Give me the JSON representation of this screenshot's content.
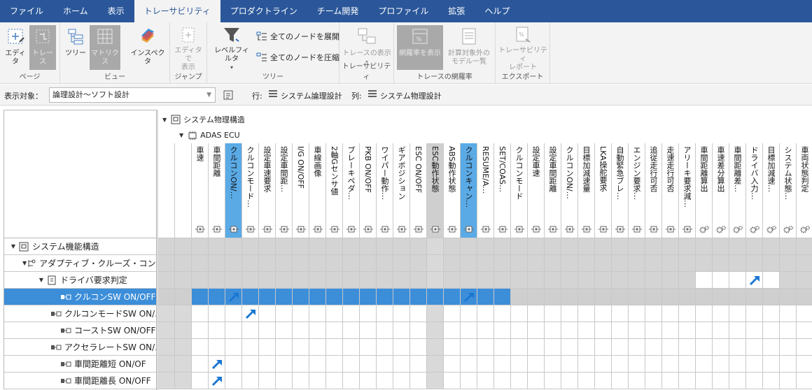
{
  "menu": {
    "tabs": [
      "ファイル",
      "ホーム",
      "表示",
      "トレーサビリティ",
      "プロダクトライン",
      "チーム開発",
      "プロファイル",
      "拡張",
      "ヘルプ"
    ],
    "active_index": 3
  },
  "ribbon": {
    "groups": {
      "page": "ページ",
      "view": "ビュー",
      "jump": "ジャンプ",
      "tree": "ツリー",
      "traceability": "トレーサビリティ",
      "coverage": "トレースの網羅率",
      "export": "エクスポート"
    },
    "buttons": {
      "editor": "エディタ",
      "trace": "トレース",
      "tree": "ツリー",
      "matrix": "マトリクス",
      "inspector": "インスペクタ",
      "show_in_editor_1": "エディタで",
      "show_in_editor_2": "表示",
      "level_filter": "レベルフィルタ",
      "expand_all": "全てのノードを展開",
      "collapse_all": "全てのノードを圧縮",
      "trace_display": "トレースの表示",
      "coverage_display": "網羅率を表示",
      "excluded_models_1": "計算対象外の",
      "excluded_models_2": "モデル一覧",
      "trace_report_1": "トレーサビリティ",
      "trace_report_2": "レポート"
    }
  },
  "options": {
    "target_label": "表示対象：",
    "target_value": "論理設計～ソフト設計",
    "row_label": "行:",
    "row_value": "システム論理設計",
    "col_label": "列:",
    "col_value": "システム物理設計"
  },
  "columns": {
    "root": "システム物理構造",
    "ecu": "ADAS ECU",
    "items": [
      {
        "label": "車速",
        "type": "port",
        "state": "normal"
      },
      {
        "label": "車間距離",
        "type": "port",
        "state": "normal"
      },
      {
        "label": "クルコンON/…",
        "type": "port",
        "state": "highlight"
      },
      {
        "label": "クルコンモード…",
        "type": "port",
        "state": "normal"
      },
      {
        "label": "設定車速要求",
        "type": "port",
        "state": "normal"
      },
      {
        "label": "設定車間距…",
        "type": "port",
        "state": "normal"
      },
      {
        "label": "I/G ON/OFF",
        "type": "port",
        "state": "normal"
      },
      {
        "label": "車線画像",
        "type": "port",
        "state": "normal"
      },
      {
        "label": "2軸Gセンサ値",
        "type": "port",
        "state": "normal"
      },
      {
        "label": "ブレーキペダ…",
        "type": "port",
        "state": "normal"
      },
      {
        "label": "PKB ON/OFF",
        "type": "port",
        "state": "normal"
      },
      {
        "label": "ワイパー動作…",
        "type": "port",
        "state": "normal"
      },
      {
        "label": "ギアポジション",
        "type": "port",
        "state": "normal"
      },
      {
        "label": "ESC ON/OFF",
        "type": "port",
        "state": "normal"
      },
      {
        "label": "ESC動作状態",
        "type": "port",
        "state": "gray"
      },
      {
        "label": "ABS動作状態",
        "type": "port",
        "state": "normal"
      },
      {
        "label": "クルコンキャン…",
        "type": "port",
        "state": "highlight"
      },
      {
        "label": "RESUME/A…",
        "type": "port",
        "state": "normal"
      },
      {
        "label": "SET/COAS…",
        "type": "port",
        "state": "normal"
      },
      {
        "label": "クルコンモード",
        "type": "port",
        "state": "normal"
      },
      {
        "label": "設定車速",
        "type": "port",
        "state": "normal"
      },
      {
        "label": "設定車間距離",
        "type": "port",
        "state": "normal"
      },
      {
        "label": "クルコンON/…",
        "type": "port",
        "state": "normal"
      },
      {
        "label": "目標加減速量",
        "type": "port",
        "state": "normal"
      },
      {
        "label": "LKA操舵要求",
        "type": "port",
        "state": "normal"
      },
      {
        "label": "自動緊急ブレ…",
        "type": "port",
        "state": "normal"
      },
      {
        "label": "エンジン要求…",
        "type": "port",
        "state": "normal"
      },
      {
        "label": "追従走行可否",
        "type": "port",
        "state": "normal"
      },
      {
        "label": "走速走行可否",
        "type": "port",
        "state": "normal"
      },
      {
        "label": "アリーキ要求減…",
        "type": "port",
        "state": "normal"
      },
      {
        "label": "車間距離算出",
        "type": "gear",
        "state": "normal"
      },
      {
        "label": "車速差分算出",
        "type": "gear",
        "state": "normal"
      },
      {
        "label": "車間距離差…",
        "type": "gear",
        "state": "normal"
      },
      {
        "label": "ドライバ入力…",
        "type": "gear",
        "state": "normal"
      },
      {
        "label": "目標加減速…",
        "type": "gear",
        "state": "normal"
      },
      {
        "label": "システム状態…",
        "type": "gear",
        "state": "normal"
      },
      {
        "label": "車両状態判定",
        "type": "gear",
        "state": "normal"
      }
    ]
  },
  "rows": [
    {
      "label": "システム機能構造",
      "indent": 0,
      "toggle": "▼",
      "icon": "structure-icon",
      "kind": "group",
      "marks": []
    },
    {
      "label": "アダプティブ・クルーズ・コントロ…",
      "indent": 1,
      "toggle": "▼",
      "icon": "function-tree-icon",
      "kind": "group",
      "marks": []
    },
    {
      "label": "ドライバ要求判定",
      "indent": 2,
      "toggle": "▼",
      "icon": "function-icon",
      "kind": "group2",
      "marks": [
        33
      ]
    },
    {
      "label": "クルコンSW ON/OFF",
      "indent": 3,
      "toggle": "",
      "icon": "signal-icon",
      "kind": "selected",
      "marks": [
        2,
        16
      ]
    },
    {
      "label": "クルコンモードSW ON/…",
      "indent": 3,
      "toggle": "",
      "icon": "signal-icon",
      "kind": "leaf",
      "marks": [
        3
      ]
    },
    {
      "label": "コーストSW ON/OFF",
      "indent": 3,
      "toggle": "",
      "icon": "signal-icon",
      "kind": "leaf",
      "marks": []
    },
    {
      "label": "アクセラレートSW ON/…",
      "indent": 3,
      "toggle": "",
      "icon": "signal-icon",
      "kind": "leaf",
      "marks": []
    },
    {
      "label": "車間距離短 ON/OF",
      "indent": 3,
      "toggle": "",
      "icon": "signal-icon",
      "kind": "leaf",
      "marks": [
        1
      ]
    },
    {
      "label": "車間距離長 ON/OFF",
      "indent": 3,
      "toggle": "",
      "icon": "signal-icon",
      "kind": "leaf",
      "marks": [
        1
      ]
    }
  ],
  "colors": {
    "menubar": "#2b579a",
    "selection": "#3c8ed9",
    "highlight_col": "#5aaae6",
    "cell_gray": "#d4d4d4",
    "arrow": "#1b76d2"
  }
}
